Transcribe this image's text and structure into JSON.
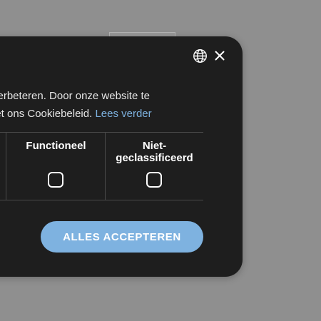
{
  "dialog": {
    "title_fragment": ".",
    "description": {
      "line1": "verbeteren. Door onze website te",
      "line2_prefix": "net ons Cookiebeleid. ",
      "read_more_link": "Lees verder"
    },
    "categories": [
      {
        "label": "Functioneel",
        "checked": false
      },
      {
        "label": "Niet-geclassificeerd",
        "checked": false
      }
    ],
    "accept_all_button": "ALLES ACCEPTEREN"
  },
  "icons": {
    "language": "globe-icon",
    "close": "close-icon"
  },
  "colors": {
    "page_background": "#8f8f8f",
    "dialog_background": "#1e1e1e",
    "accent": "#7eb2e0",
    "link": "#7db1de",
    "divider": "#4a4a4a"
  }
}
